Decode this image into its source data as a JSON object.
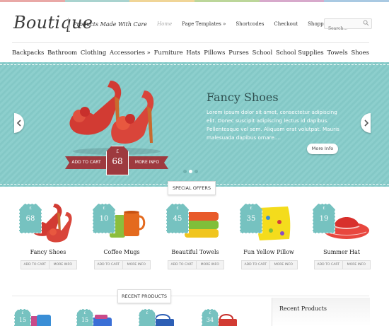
{
  "brand": {
    "logo": "Boutique",
    "tagline": "Products Made With Care"
  },
  "topnav": [
    "Home",
    "Page Templates »",
    "Shortcodes",
    "Checkout",
    "Shopping Cart"
  ],
  "search": {
    "placeholder": "Search..."
  },
  "categories": [
    "Backpacks",
    "Bathroom",
    "Clothing",
    "Accessories »",
    "Furniture",
    "Hats",
    "Pillows",
    "Purses",
    "School",
    "School Supplies",
    "Towels",
    "Shoes"
  ],
  "slider": {
    "title": "Fancy Shoes",
    "text": "Lorem ipsum dolor sit amet, consectetur adipiscing elit. Donec suscipit adipiscing lectus id dapibus. Pellentesque vel sem. Aliquam erat volutpat. Mauris malesuada dapibus ornare....",
    "more_info": "More Info",
    "add_to_cart": "ADD TO CART",
    "ribbon_more": "MORE INFO",
    "currency": "£",
    "price": "68"
  },
  "special_offers": {
    "label": "SPECIAL OFFERS",
    "add_to_cart": "ADD TO CART",
    "more_info": "MORE INFO",
    "currency": "£",
    "products": [
      {
        "name": "Fancy Shoes",
        "price": "68"
      },
      {
        "name": "Coffee Mugs",
        "price": "10"
      },
      {
        "name": "Beautiful Towels",
        "price": "45"
      },
      {
        "name": "Fun Yellow Pillow",
        "price": "35"
      },
      {
        "name": "Summer Hat",
        "price": "19"
      }
    ]
  },
  "recent_products": {
    "label": "RECENT PRODUCTS",
    "currency": "£",
    "prices": [
      "15",
      "15",
      "",
      "34"
    ]
  },
  "sidebar": {
    "title": "Recent Products"
  },
  "colors": {
    "teal": "#86ccca",
    "tag": "#76c2c0",
    "ribbon": "#9e3a3f"
  }
}
